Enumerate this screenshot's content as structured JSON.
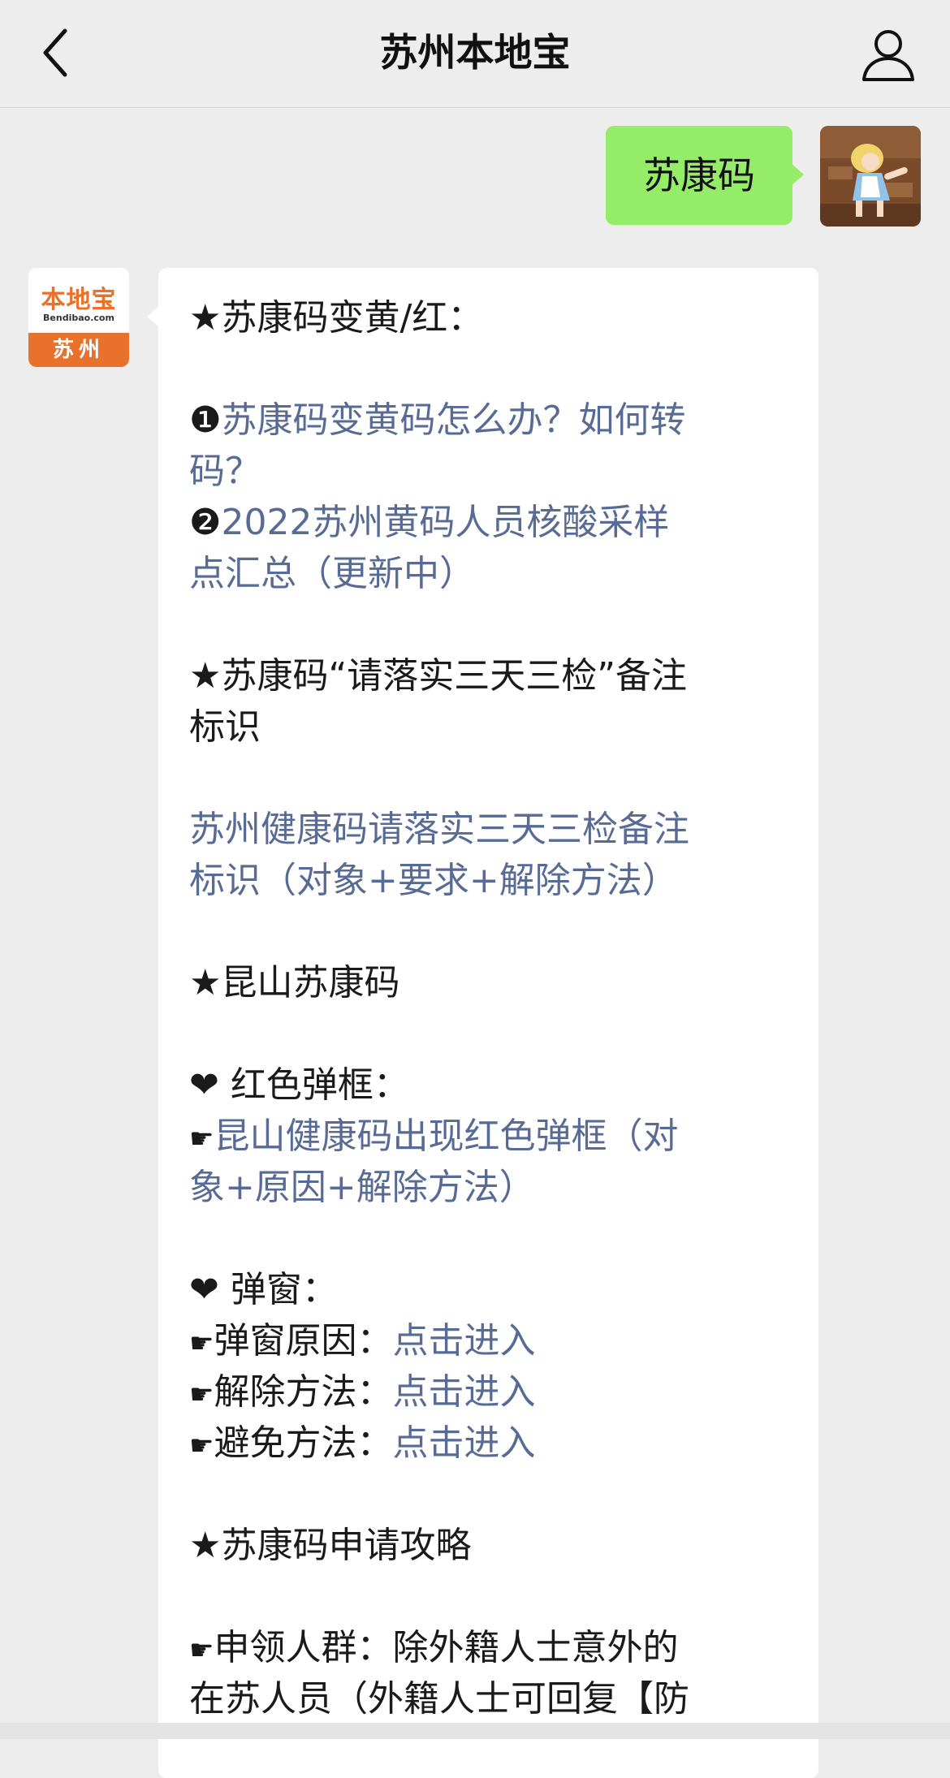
{
  "header": {
    "title": "苏州本地宝"
  },
  "messages": {
    "outgoing": {
      "text": "苏康码"
    },
    "incoming_avatar": {
      "logo_main": "本地宝",
      "logo_sub": "Bendibao.com",
      "city": "苏州"
    },
    "incoming": {
      "section1_title": "★苏康码变黄/红：",
      "item1_num": "❶",
      "item1_link_a": "苏康码变黄码怎么办？如何转",
      "item1_link_b": "码？",
      "item2_num": "❷",
      "item2_link_a": "2022苏州黄码人员核酸采样",
      "item2_link_b": "点汇总（更新中）",
      "section2_title_a": "★苏康码“请落实三天三检”备注",
      "section2_title_b": "标识",
      "section2_link_a": "苏州健康码请落实三天三检备注",
      "section2_link_b": "标识（对象+要求+解除方法）",
      "section3_title": "★昆山苏康码",
      "red_popup_title": "❤ 红色弹框：",
      "red_popup_link_a": "昆山健康码出现红色弹框（对",
      "red_popup_link_b": "象+原因+解除方法）",
      "popup_title": "❤ 弹窗：",
      "popup_rows": [
        {
          "hand": "☛",
          "label": "弹窗原因：",
          "link": "点击进入"
        },
        {
          "hand": "☛",
          "label": "解除方法：",
          "link": "点击进入"
        },
        {
          "hand": "☛",
          "label": "避免方法：",
          "link": "点击进入"
        }
      ],
      "section4_title": "★苏康码申请攻略",
      "apply_hand": "☛",
      "apply_line_a": "申领人群：除外籍人士意外的",
      "apply_line_b": "在苏人员（外籍人士可回复【防"
    }
  }
}
